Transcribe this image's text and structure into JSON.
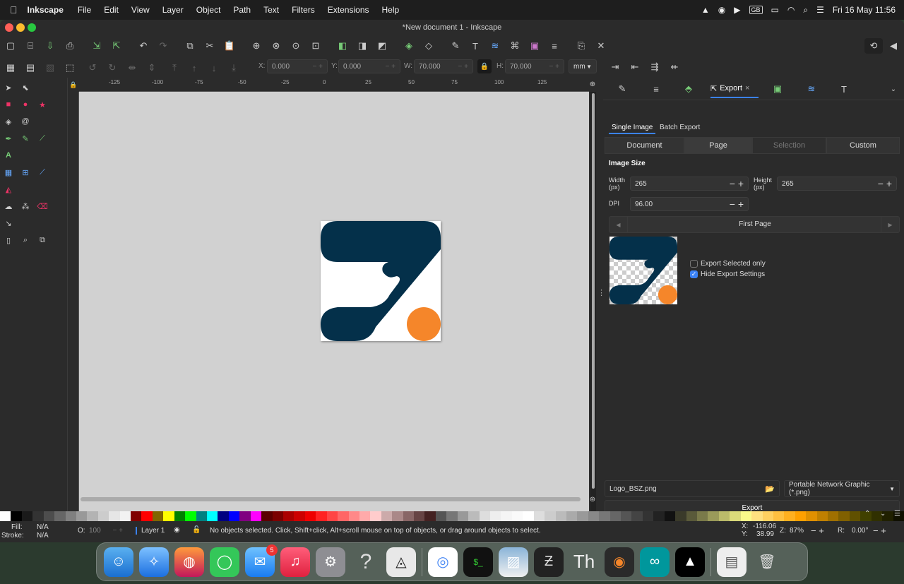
{
  "menubar": {
    "apple": "",
    "app_name": "Inkscape",
    "items": [
      "File",
      "Edit",
      "View",
      "Layer",
      "Object",
      "Path",
      "Text",
      "Filters",
      "Extensions",
      "Help"
    ],
    "date_time": "Fri 16 May  11:56",
    "input_source": "GB"
  },
  "window": {
    "title": "*New document 1 - Inkscape"
  },
  "toolbar": {
    "x_label": "X:",
    "x_value": "0.000",
    "y_label": "Y:",
    "y_value": "0.000",
    "w_label": "W:",
    "w_value": "70.000",
    "h_label": "H:",
    "h_value": "70.000",
    "unit": "mm"
  },
  "ruler": {
    "ticks": [
      "-125",
      "-100",
      "-75",
      "-50",
      "-25",
      "0",
      "25",
      "50",
      "75",
      "100",
      "125"
    ]
  },
  "panel": {
    "tab_label": "Export",
    "close": "×",
    "subtabs": [
      "Single Image",
      "Batch Export"
    ],
    "areas": [
      "Document",
      "Page",
      "Selection",
      "Custom"
    ],
    "image_size_heading": "Image Size",
    "width_label": "Width\n(px)",
    "width_value": "265",
    "height_label": "Height\n(px)",
    "height_value": "265",
    "dpi_label": "DPI",
    "dpi_value": "96.00",
    "page_nav_label": "First Page",
    "export_selected_only": "Export Selected only",
    "hide_export_settings": "Hide Export Settings",
    "filename": "Logo_BSZ.png",
    "format": "Portable Network Graphic (*.png)",
    "export_button": "Export"
  },
  "status": {
    "fill_label": "Fill:",
    "fill_value": "N/A",
    "stroke_label": "Stroke:",
    "stroke_value": "N/A",
    "opacity_label": "O:",
    "opacity_value": "100",
    "layer": "Layer 1",
    "message": "No objects selected. Click, Shift+click, Alt+scroll mouse on top of objects, or drag around objects to select.",
    "x_label": "X:",
    "x_value": "-116.06",
    "y_label": "Y:",
    "y_value": "38.99",
    "zoom_label": "Z:",
    "zoom_value": "87%",
    "rotate_label": "R:",
    "rotate_value": "0.00°"
  },
  "dock": {
    "mail_badge": "5"
  },
  "colors": {
    "logo_dark": "#04304a",
    "logo_orange": "#f5862a",
    "accent": "#3b82f6"
  }
}
